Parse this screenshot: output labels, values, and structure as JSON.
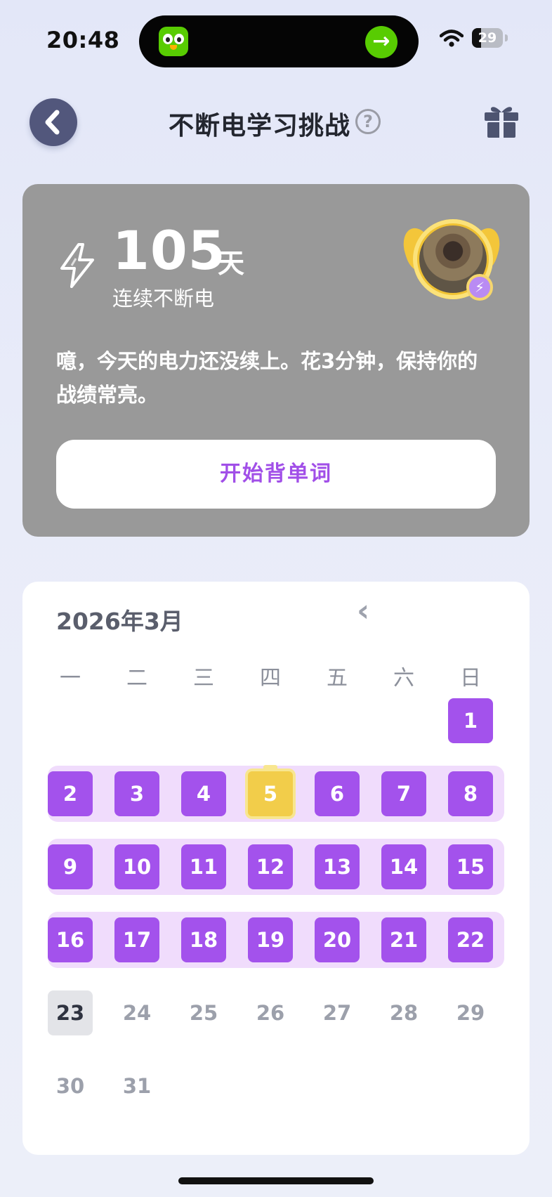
{
  "status": {
    "time": "20:48",
    "battery": "29",
    "battery_level": 0.29
  },
  "header": {
    "title": "不断电学习挑战"
  },
  "streak": {
    "count": "105",
    "unit": "天",
    "subtitle": "连续不断电",
    "message": "噫，今天的电力还没续上。花3分钟，保持你的战绩常亮。",
    "start_button": "开始背单词"
  },
  "calendar": {
    "title": "2026年3月",
    "weekdays": [
      "一",
      "二",
      "三",
      "四",
      "五",
      "六",
      "日"
    ],
    "days": [
      {
        "label": "1",
        "state": "done"
      },
      {
        "label": "2",
        "state": "done"
      },
      {
        "label": "3",
        "state": "done"
      },
      {
        "label": "4",
        "state": "done"
      },
      {
        "label": "5",
        "state": "gold"
      },
      {
        "label": "6",
        "state": "done"
      },
      {
        "label": "7",
        "state": "done"
      },
      {
        "label": "8",
        "state": "done"
      },
      {
        "label": "9",
        "state": "done"
      },
      {
        "label": "10",
        "state": "done"
      },
      {
        "label": "11",
        "state": "done"
      },
      {
        "label": "12",
        "state": "done"
      },
      {
        "label": "13",
        "state": "done"
      },
      {
        "label": "14",
        "state": "done"
      },
      {
        "label": "15",
        "state": "done"
      },
      {
        "label": "16",
        "state": "done"
      },
      {
        "label": "17",
        "state": "done"
      },
      {
        "label": "18",
        "state": "done"
      },
      {
        "label": "19",
        "state": "done"
      },
      {
        "label": "20",
        "state": "done"
      },
      {
        "label": "21",
        "state": "done"
      },
      {
        "label": "22",
        "state": "done"
      },
      {
        "label": "23",
        "state": "today"
      },
      {
        "label": "24",
        "state": "future"
      },
      {
        "label": "25",
        "state": "future"
      },
      {
        "label": "26",
        "state": "future"
      },
      {
        "label": "27",
        "state": "future"
      },
      {
        "label": "28",
        "state": "future"
      },
      {
        "label": "29",
        "state": "future"
      },
      {
        "label": "30",
        "state": "future"
      },
      {
        "label": "31",
        "state": "future"
      }
    ]
  },
  "colors": {
    "accent": "#a352ec",
    "card_gray": "#999999",
    "gold": "#f2cd4a",
    "band": "#f0dcfc"
  },
  "icons": [
    "duolingo-app-icon",
    "arrow-right-icon",
    "wifi-icon",
    "battery-icon",
    "back-chevron-icon",
    "help-icon",
    "gift-icon",
    "bolt-icon",
    "prev-month-chevron-icon"
  ]
}
